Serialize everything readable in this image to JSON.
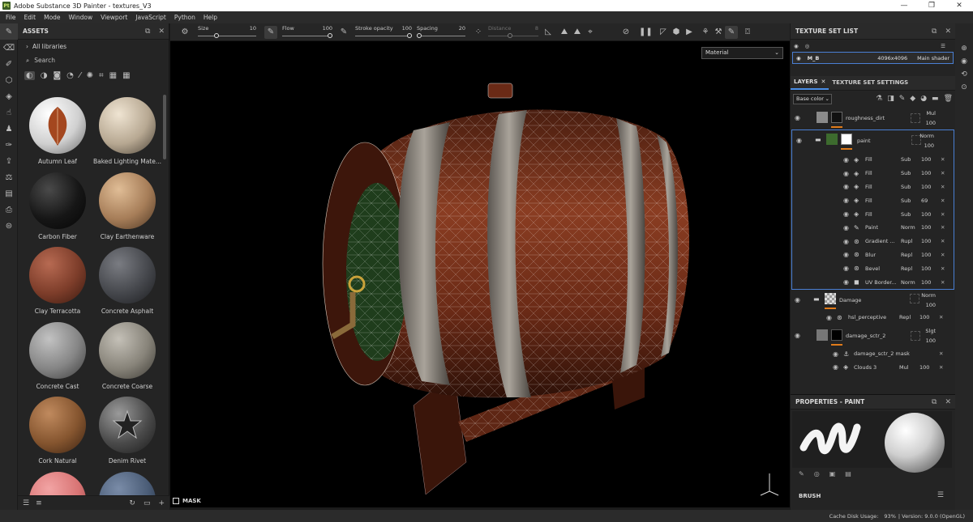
{
  "window": {
    "title": "Adobe Substance 3D Painter - textures_V3",
    "app_icon": "Pt",
    "controls": {
      "minimize": "—",
      "maximize": "❐",
      "close": "✕"
    }
  },
  "menu": [
    "File",
    "Edit",
    "Mode",
    "Window",
    "Viewport",
    "JavaScript",
    "Python",
    "Help"
  ],
  "assets": {
    "title": "ASSETS",
    "library": "All libraries",
    "search_placeholder": "Search",
    "items": [
      {
        "name": "Autumn Leaf",
        "color": "#e8e8e8"
      },
      {
        "name": "Baked Lighting Mate...",
        "color": "#c9b9a2"
      },
      {
        "name": "Carbon Fiber",
        "color": "#1a1a1a"
      },
      {
        "name": "Clay Earthenware",
        "color": "#b48b64"
      },
      {
        "name": "Clay Terracotta",
        "color": "#8a4330"
      },
      {
        "name": "Concrete Asphalt",
        "color": "#4b4d52"
      },
      {
        "name": "Concrete Cast",
        "color": "#8d8d8d"
      },
      {
        "name": "Concrete Coarse",
        "color": "#8e8b84"
      },
      {
        "name": "Cork Natural",
        "color": "#8e5e3b"
      },
      {
        "name": "Denim Rivet",
        "color": "#555555"
      },
      {
        "name": "",
        "color": "#e58484"
      },
      {
        "name": "",
        "color": "#4c5e78"
      }
    ]
  },
  "toolbar": {
    "size_label": "Size",
    "size_value": "10",
    "flow_label": "Flow",
    "flow_value": "100",
    "stroke_label": "Stroke opacity",
    "stroke_value": "100",
    "spacing_label": "Spacing",
    "spacing_value": "20",
    "distance_label": "Distance",
    "distance_value": "8"
  },
  "viewport": {
    "display_mode": "Material",
    "mask_label": "MASK"
  },
  "texture_set_list": {
    "title": "TEXTURE SET LIST",
    "item_name": "M_B",
    "resolution": "4096x4096",
    "shader": "Main shader"
  },
  "layers_panel": {
    "tab_layers": "LAYERS",
    "tab_settings": "TEXTURE SET SETTINGS",
    "channel": "Base color",
    "layers": [
      {
        "name": "roughness_dirt",
        "blend": "Mul",
        "opacity": "100"
      },
      {
        "name": "paint",
        "blend": "Norm",
        "opacity": "100"
      }
    ],
    "paint_effects": [
      {
        "name": "Fill",
        "blend": "Sub",
        "opacity": "100",
        "icon": "fill-icon"
      },
      {
        "name": "Fill",
        "blend": "Sub",
        "opacity": "100",
        "icon": "fill-icon"
      },
      {
        "name": "Fill",
        "blend": "Sub",
        "opacity": "100",
        "icon": "fill-icon"
      },
      {
        "name": "Fill",
        "blend": "Sub",
        "opacity": "69",
        "icon": "fill-icon"
      },
      {
        "name": "Fill",
        "blend": "Sub",
        "opacity": "100",
        "icon": "fill-icon"
      },
      {
        "name": "Paint",
        "blend": "Norm",
        "opacity": "100",
        "icon": "brush-icon"
      },
      {
        "name": "Gradient ...",
        "blend": "Rupl",
        "opacity": "100",
        "icon": "filter-icon"
      },
      {
        "name": "Blur",
        "blend": "Repl",
        "opacity": "100",
        "icon": "filter-icon"
      },
      {
        "name": "Bevel",
        "blend": "Repl",
        "opacity": "100",
        "icon": "filter-icon"
      },
      {
        "name": "UV Border...",
        "blend": "Norm",
        "opacity": "100",
        "icon": "generator-icon"
      }
    ],
    "damage": {
      "name": "Damage",
      "blend": "Norm",
      "opacity": "100"
    },
    "hsl": {
      "name": "hsl_perceptive",
      "blend": "Repl",
      "opacity": "100"
    },
    "damage_sctr": {
      "name": "damage_sctr_2",
      "blend": "Slgt",
      "opacity": "100"
    },
    "damage_mask": {
      "name": "damage_sctr_2 mask"
    },
    "clouds": {
      "name": "Clouds 3",
      "blend": "Mul",
      "opacity": "100"
    }
  },
  "properties": {
    "title": "PROPERTIES - PAINT",
    "brush_label": "BRUSH"
  },
  "status": {
    "cache_label": "Cache Disk Usage:",
    "cache_value": "93%",
    "version": "| Version: 9.0.0 (OpenGL)"
  }
}
